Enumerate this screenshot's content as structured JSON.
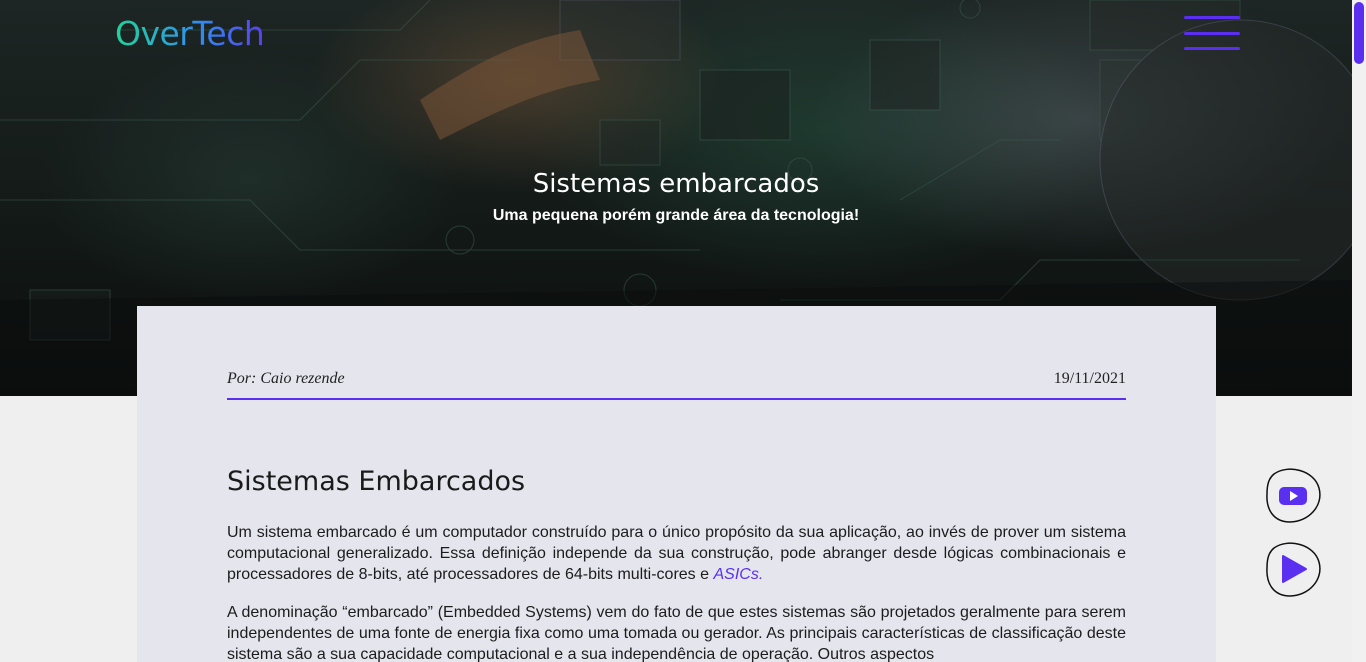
{
  "header": {
    "logo": "OverTech",
    "menu_icon": "hamburger-menu-icon"
  },
  "hero": {
    "title": "Sistemas embarcados",
    "subtitle": "Uma pequena porém grande área da tecnologia!"
  },
  "article": {
    "author": "Por: Caio rezende",
    "date": "19/11/2021",
    "heading": "Sistemas Embarcados",
    "paragraph1_text": "Um sistema embarcado é um computador construído para o único propósito da sua aplicação, ao invés de prover um sistema computacional generalizado. Essa definição independe da sua construção, pode abranger desde lógicas combinacionais e processadores de 8-bits, até processadores de 64-bits multi-cores e ",
    "paragraph1_link": "ASICs.",
    "paragraph2_text": "A denominação “embarcado” (Embedded Systems) vem do fato de que estes sistemas são projetados geralmente para serem independentes de uma fonte de energia fixa como uma tomada ou gerador. As principais características de classificação deste sistema são a sua capacidade computacional e a sua independência de operação. Outros aspectos"
  },
  "side_buttons": [
    {
      "icon": "youtube-icon"
    },
    {
      "icon": "play-icon"
    }
  ],
  "colors": {
    "accent": "#5b2ff0",
    "article_bg": "#e5e5ee",
    "page_bg": "#efefef"
  }
}
